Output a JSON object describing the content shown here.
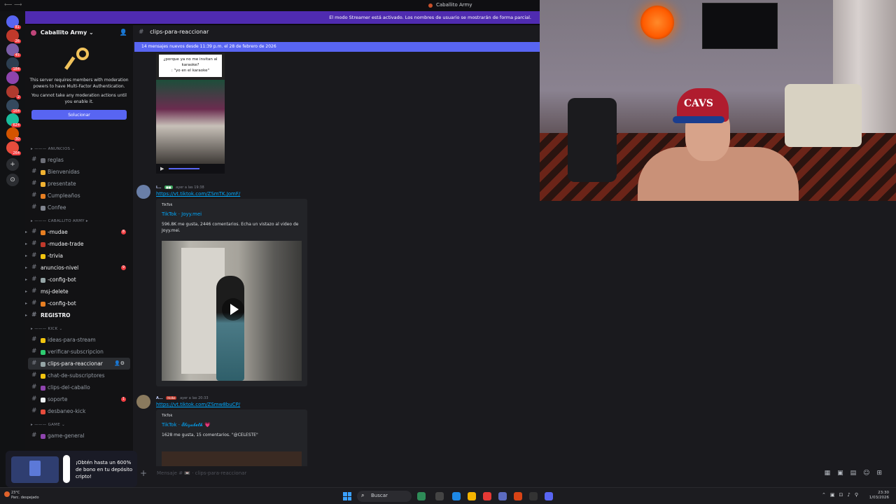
{
  "titlebar": {
    "title": "Caballito Army"
  },
  "streamer_notice": "El modo Streamer está activado. Los nombres de usuario se mostrarán de forma parcial.",
  "rail": {
    "servers": [
      {
        "color": "#5865f2",
        "badge": "81"
      },
      {
        "color": "#c0392b",
        "badge": "26"
      },
      {
        "color": "#7b5ea7",
        "badge": "45"
      },
      {
        "color": "#2c3e50",
        "badge": "184"
      },
      {
        "color": "#8e44ad",
        "badge": ""
      },
      {
        "color": "#b03a2e",
        "badge": "2"
      },
      {
        "color": "#34495e",
        "badge": "164"
      },
      {
        "color": "#1abc9c",
        "badge": "624"
      },
      {
        "color": "#d35400",
        "badge": "30"
      },
      {
        "color": "#e74c3c",
        "badge": "264"
      }
    ]
  },
  "server": {
    "name": "Caballito Army ⌄"
  },
  "mfa": {
    "text1": "This server requires members with moderation powers to have Multi-Factor Authentication.",
    "text2": "You cannot take any moderation actions until you enable it.",
    "button": "Solucionar"
  },
  "categories": {
    "anuncios": "ANUNCIOS",
    "caballito": "CABALLITO ARMY",
    "kick": "KICK",
    "game": "GAME"
  },
  "channels_anuncios": [
    {
      "name": "reglas",
      "color": "#6d6f78"
    },
    {
      "name": "Bienvenidas",
      "color": "#f0b232"
    },
    {
      "name": "presentate",
      "color": "#f0b232"
    },
    {
      "name": "Cumpleaños",
      "color": "#e67e22"
    },
    {
      "name": "Confee",
      "color": "#80848e"
    }
  ],
  "channels_caballito": [
    {
      "name": "-mudae",
      "color": "#e67e22",
      "badge": "8"
    },
    {
      "name": "-mudae-trade",
      "color": "#c0392b",
      "badge": ""
    },
    {
      "name": "-trivia",
      "color": "#f1c40f",
      "badge": ""
    },
    {
      "name": "anuncios-nivel",
      "color": "",
      "badge": "9"
    },
    {
      "name": "-config-bot",
      "color": "#95a5a6",
      "badge": ""
    },
    {
      "name": "msj-delete",
      "color": "",
      "badge": ""
    },
    {
      "name": "-config-bot",
      "color": "#e67e22",
      "badge": ""
    },
    {
      "name": "REGISTRO",
      "color": "",
      "badge": ""
    }
  ],
  "channels_kick": [
    {
      "name": "ideas-para-stream",
      "color": "#f1c40f"
    },
    {
      "name": "verificar-subscripcion",
      "color": "#2ecc71"
    },
    {
      "name": "clips-para-reaccionar",
      "color": "#95a5a6"
    },
    {
      "name": "chat-de-subscriptores",
      "color": "#f1c40f"
    },
    {
      "name": "clips-del-caballo",
      "color": "#8e44ad"
    },
    {
      "name": "soporte",
      "color": "#ecf0f1"
    },
    {
      "name": "desbaneo-kick",
      "color": "#e74c3c"
    }
  ],
  "soporte_badge": "1",
  "channels_game": [
    {
      "name": "game-general",
      "color": "#8e44ad"
    }
  ],
  "chat": {
    "channel": "clips-para-reaccionar",
    "new_messages": "14 mensajes nuevos desde 11:39 p.m. el 28 de febrero de 2026",
    "meme_caption_1": "¿porque ya no me invitan al karaoke?",
    "meme_caption_2": ": \"yo en el karaoke\"",
    "msg1": {
      "name": "i...",
      "time": "ayer a las 19:38",
      "link": "https://vt.tiktok.com/ZSmTK.JomF/",
      "provider": "TikTok",
      "title": "TikTok · Joyy.mei",
      "desc": "596.8K me gusta, 2446 comentarios. Echa un vistazo al video de Joyy.mei."
    },
    "msg2": {
      "name": "A...",
      "tag": "Holke",
      "time": "ayer a las 20:33",
      "link": "https://vt.tiktok.com/ZSmw8buCP/",
      "provider": "TikTok",
      "title": "TikTok · 𝓔𝓵𝓲𝔃𝓪𝓫𝓮𝓽𝓱 💗",
      "desc": "1628 me gusta, 15 comentarios. \"@CELESTE\""
    },
    "composer_placeholder": "Mensaje # 📼 · clips-para-reaccionar"
  },
  "promo": {
    "text": "¡Obtén hasta un 600% de bono en tu depósito cripto!"
  },
  "taskbar": {
    "temp": "23°C",
    "weather": "Parc. despejado",
    "search": "Buscar",
    "time": "23:30",
    "date": "1/03/2026"
  }
}
